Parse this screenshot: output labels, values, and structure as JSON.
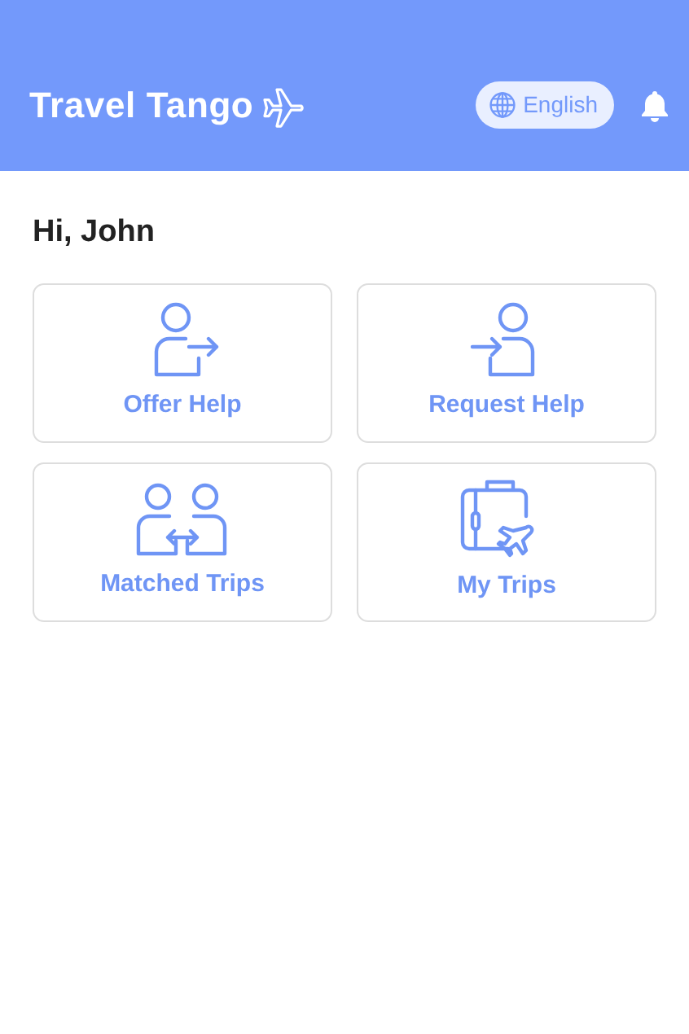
{
  "header": {
    "logo": "Travel Tango",
    "language": "English"
  },
  "greeting": "Hi, John",
  "tiles": [
    {
      "kind": "offer",
      "label": "Offer Help"
    },
    {
      "kind": "request",
      "label": "Request Help"
    },
    {
      "kind": "matched",
      "label": "Matched Trips"
    },
    {
      "kind": "trips",
      "label": "My Trips"
    }
  ]
}
